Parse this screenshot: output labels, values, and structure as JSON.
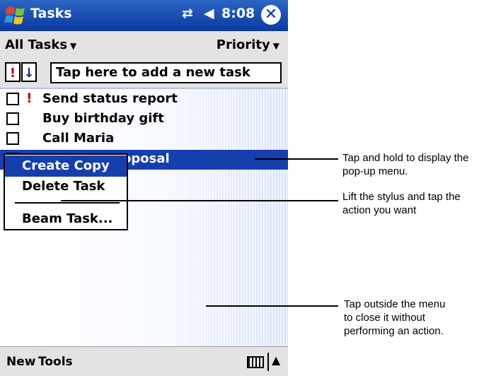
{
  "titlebar": {
    "title": "Tasks",
    "time": "8:08",
    "connectivity_icon": "⇄",
    "volume_icon": "◀",
    "close_icon": "✕"
  },
  "filterbar": {
    "filter": "All Tasks",
    "sort": "Priority"
  },
  "entrybar": {
    "priority_button": "!",
    "sort_button": "↓",
    "placeholder": "Tap here to add a new task"
  },
  "tasks": [
    {
      "label": "Send status report",
      "priority_mark": "!",
      "high_priority": true
    },
    {
      "label": "Buy birthday gift",
      "priority_mark": "",
      "high_priority": false
    },
    {
      "label": "Call Maria",
      "priority_mark": "",
      "high_priority": false
    },
    {
      "label": "oposal",
      "priority_mark": "",
      "high_priority": false,
      "selected": true
    }
  ],
  "popup_menu": {
    "items": [
      "Create Copy",
      "Delete Task",
      "Beam Task..."
    ]
  },
  "menubar": {
    "new": "New",
    "tools": "Tools",
    "sip_arrow": "▲"
  },
  "callouts": {
    "c1": "Tap and hold to display the pop-up menu.",
    "c2": "Lift the stylus and tap the action you want",
    "c3": "Tap outside the menu to close it without performing an action."
  },
  "colors": {
    "titlebar": "#0a3aa0",
    "selection": "#163fae",
    "priority": "#c00000"
  }
}
